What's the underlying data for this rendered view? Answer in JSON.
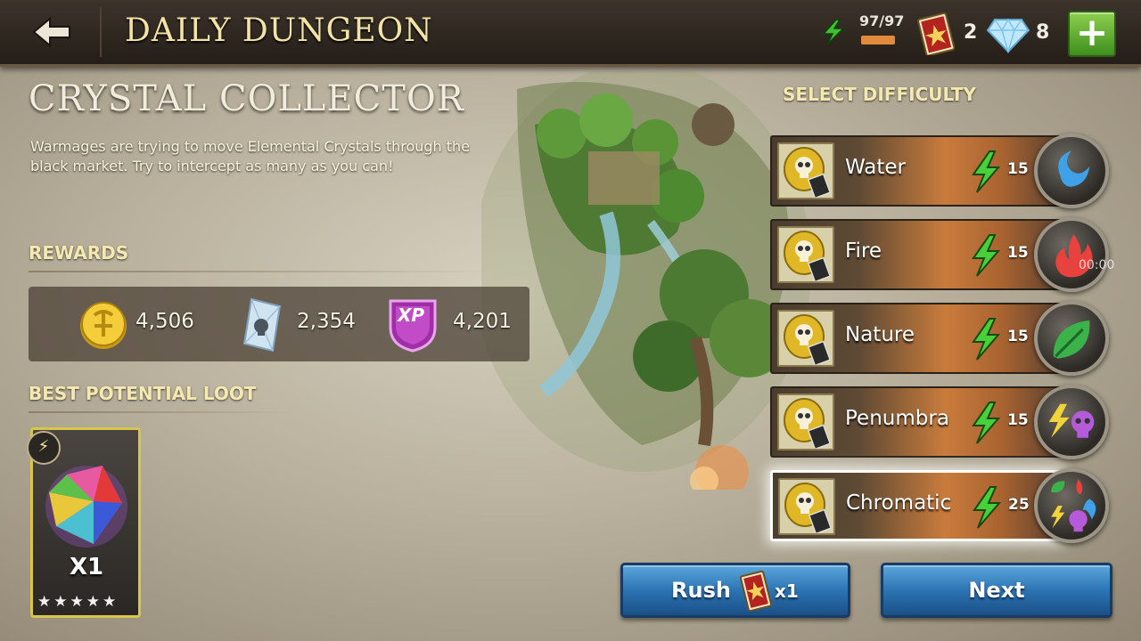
{
  "header": {
    "title": "DAILY DUNGEON",
    "energy": "97/97",
    "energy_fill": 1.0,
    "tickets": "2",
    "gems": "8",
    "add_label": "+"
  },
  "dungeon": {
    "name": "CRYSTAL COLLECTOR",
    "description": "Warmages are trying to move Elemental Crystals through the black market. Try to intercept as many as you can!"
  },
  "rewards": {
    "label": "REWARDS",
    "gold": "4,506",
    "crystals": "2,354",
    "xp_badge": "XP",
    "xp": "4,201"
  },
  "loot": {
    "label": "BEST POTENTIAL LOOT",
    "quantity": "X1",
    "stars": "★★★★★",
    "rating": 5,
    "badge": "⚡"
  },
  "difficulty": {
    "label": "SELECT DIFFICULTY",
    "selected": "Chromatic",
    "rows": [
      {
        "name": "Water",
        "cost": "15",
        "icon": "water-icon"
      },
      {
        "name": "Fire",
        "cost": "15",
        "icon": "fire-icon"
      },
      {
        "name": "Nature",
        "cost": "15",
        "icon": "leaf-icon"
      },
      {
        "name": "Penumbra",
        "cost": "15",
        "icon": "lightning-skull-icon"
      },
      {
        "name": "Chromatic",
        "cost": "25",
        "icon": "multi-element-icon"
      }
    ],
    "timer": "00:00"
  },
  "buttons": {
    "rush": "Rush",
    "rush_qty": "x1",
    "next": "Next"
  },
  "colors": {
    "title": "#f3e3a6",
    "button_blue": "#2c74b4",
    "plus_green": "#5cab2f",
    "energy_orange": "#e08a3c"
  }
}
